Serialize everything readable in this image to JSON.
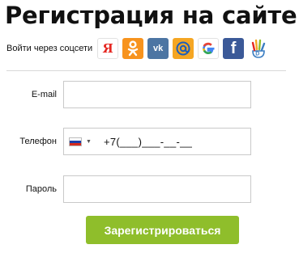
{
  "page": {
    "title": "Регистрация на сайте"
  },
  "social": {
    "label": "Войти через соцсети",
    "providers": [
      {
        "name": "yandex",
        "glyph": "Я"
      },
      {
        "name": "odnoklassniki",
        "glyph": ""
      },
      {
        "name": "vkontakte",
        "glyph": "vk"
      },
      {
        "name": "mail-ru",
        "glyph": "@"
      },
      {
        "name": "google",
        "glyph": "G"
      },
      {
        "name": "facebook",
        "glyph": "f"
      },
      {
        "name": "dnevnik",
        "glyph": ""
      }
    ]
  },
  "form": {
    "email": {
      "label": "E-mail",
      "value": ""
    },
    "phone": {
      "label": "Телефон",
      "country": "ru",
      "mask": "+7(___)___-__-__"
    },
    "password": {
      "label": "Пароль",
      "value": ""
    },
    "submit_label": "Зарегистрироваться"
  },
  "colors": {
    "submit": "#8fbe2b",
    "yandex": "#e52620",
    "ok": "#f7931e",
    "vk": "#4c75a3",
    "mail": "#f5a623",
    "facebook": "#3b5998"
  }
}
